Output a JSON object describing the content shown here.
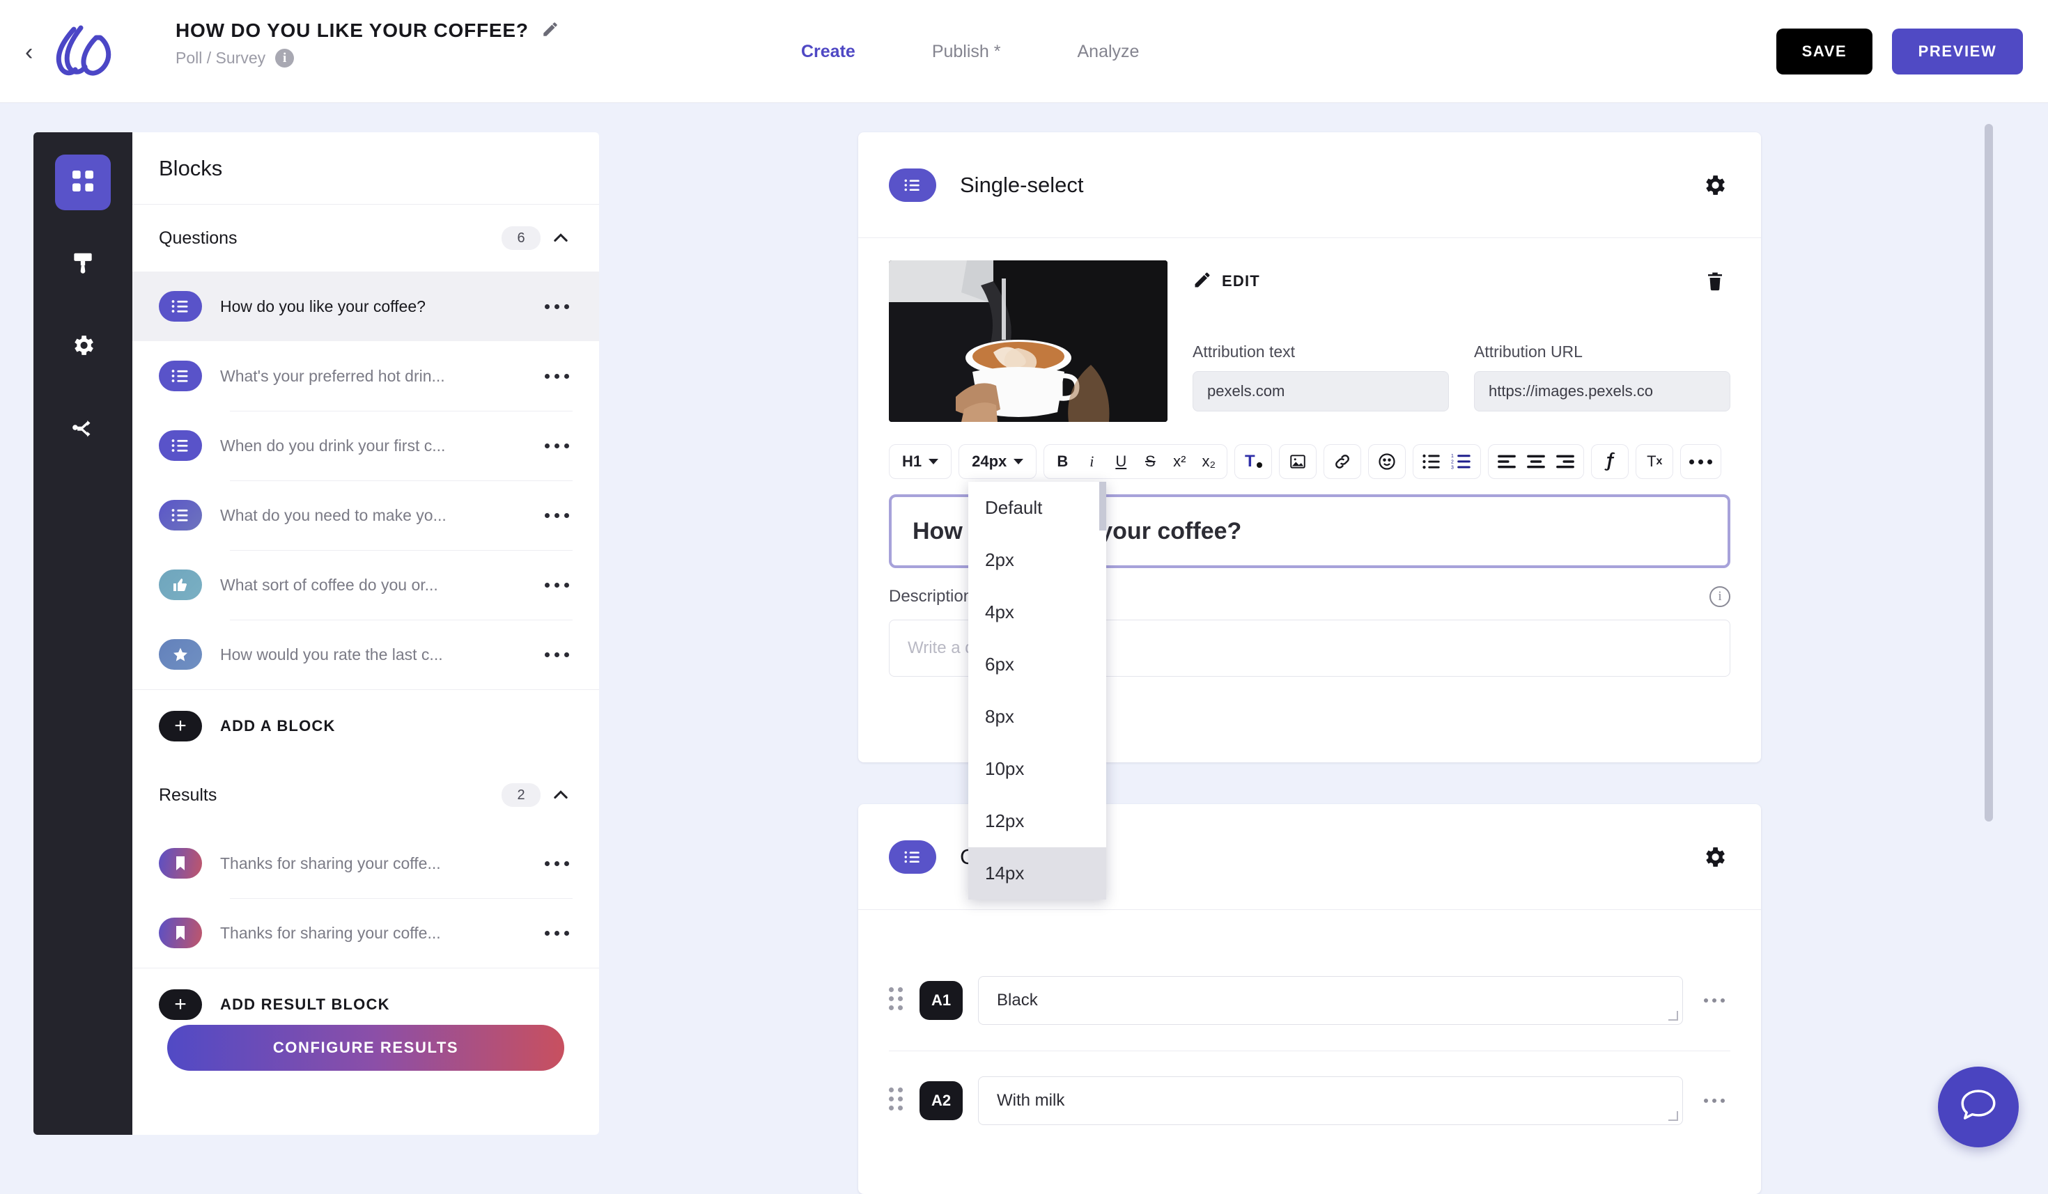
{
  "header": {
    "back_icon": "chevron-left-icon",
    "logo_icon": "brand-logo-icon",
    "doc_title": "HOW DO YOU LIKE YOUR COFFEE?",
    "edit_title_icon": "pencil-icon",
    "doc_subtitle": "Poll / Survey",
    "info_icon": "info-icon",
    "info_glyph": "i",
    "tabs": [
      {
        "label": "Create",
        "active": true
      },
      {
        "label": "Publish *",
        "active": false
      },
      {
        "label": "Analyze",
        "active": false
      }
    ],
    "save_label": "SAVE",
    "preview_label": "PREVIEW",
    "accent_color": "#504ac4",
    "save_color": "#000000"
  },
  "rail": {
    "items": [
      {
        "icon": "blocks-grid-icon",
        "active": true
      },
      {
        "icon": "paintbrush-icon",
        "active": false
      },
      {
        "icon": "gear-icon",
        "active": false
      },
      {
        "icon": "share-branch-icon",
        "active": false
      }
    ]
  },
  "blocks_panel": {
    "title": "Blocks",
    "questions_section": {
      "title": "Questions",
      "count": "6",
      "collapse_icon": "chevron-up-icon",
      "items": [
        {
          "label": "How do you like your coffee?",
          "icon": "single-select-icon",
          "badge_color": "#5953c9",
          "selected": true
        },
        {
          "label": "What's your preferred hot drin...",
          "icon": "single-select-icon",
          "badge_color": "#5953c9",
          "selected": false
        },
        {
          "label": "When do you drink your first c...",
          "icon": "single-select-icon",
          "badge_color": "#5953c9",
          "selected": false
        },
        {
          "label": "What do you need to make yo...",
          "icon": "multi-select-icon",
          "badge_color": "#5a62bf",
          "selected": false
        },
        {
          "label": "What sort of coffee do you or...",
          "icon": "thumbs-up-icon",
          "badge_color": "#6aa3bb",
          "selected": false
        },
        {
          "label": "How would you rate the last c...",
          "icon": "star-icon",
          "badge_color": "#6483b9",
          "selected": false
        }
      ],
      "add_label": "ADD A BLOCK",
      "add_icon": "plus-icon"
    },
    "results_section": {
      "title": "Results",
      "count": "2",
      "collapse_icon": "chevron-up-icon",
      "items": [
        {
          "label": "Thanks for sharing your coffe...",
          "icon": "bookmark-icon"
        },
        {
          "label": "Thanks for sharing your coffe...",
          "icon": "bookmark-icon"
        }
      ],
      "add_label": "ADD RESULT BLOCK",
      "add_icon": "plus-icon"
    },
    "configure_label": "CONFIGURE RESULTS",
    "row_menu_icon": "more-horizontal-icon"
  },
  "question_card": {
    "badge_icon": "single-select-icon",
    "title": "Single-select",
    "settings_icon": "gear-icon",
    "image_alt": "barista pouring latte art",
    "edit_label": "EDIT",
    "edit_icon": "pencil-icon",
    "delete_icon": "trash-icon",
    "attribution_text_label": "Attribution text",
    "attribution_text_value": "pexels.com",
    "attribution_url_label": "Attribution URL",
    "attribution_url_value": "https://images.pexels.co",
    "toolbar": {
      "heading_value": "H1",
      "font_size_value": "24px",
      "buttons": [
        {
          "icon": "bold-icon",
          "glyph": "B"
        },
        {
          "icon": "italic-icon",
          "glyph": "i"
        },
        {
          "icon": "underline-icon",
          "glyph": "U"
        },
        {
          "icon": "strikethrough-icon",
          "glyph": "S"
        },
        {
          "icon": "superscript-icon",
          "glyph": "x²"
        },
        {
          "icon": "subscript-icon",
          "glyph": "x₂"
        },
        {
          "icon": "text-color-icon",
          "glyph": "T"
        },
        {
          "icon": "image-icon",
          "glyph": ""
        },
        {
          "icon": "link-icon",
          "glyph": ""
        },
        {
          "icon": "emoji-icon",
          "glyph": ""
        },
        {
          "icon": "bullet-list-icon",
          "glyph": ""
        },
        {
          "icon": "numbered-list-icon",
          "glyph": ""
        },
        {
          "icon": "align-left-icon",
          "glyph": ""
        },
        {
          "icon": "align-center-icon",
          "glyph": ""
        },
        {
          "icon": "align-right-icon",
          "glyph": ""
        },
        {
          "icon": "formula-icon",
          "glyph": ""
        },
        {
          "icon": "clear-formatting-icon",
          "glyph": "Tx"
        },
        {
          "icon": "more-horizontal-icon",
          "glyph": ""
        }
      ]
    },
    "question_value": "How do you like your coffee?",
    "description_label": "Description",
    "description_info_icon": "info-icon",
    "description_placeholder": "Write a description.",
    "focus_ring_color": "#a7a2da"
  },
  "font_size_menu": {
    "options": [
      "Default",
      "2px",
      "4px",
      "6px",
      "8px",
      "10px",
      "12px",
      "14px"
    ],
    "highlighted": "14px"
  },
  "content_card": {
    "badge_icon": "single-select-icon",
    "title": "Content",
    "settings_icon": "gear-icon",
    "answers": [
      {
        "key": "A1",
        "value": "Black",
        "drag_icon": "drag-handle-icon",
        "menu_icon": "more-horizontal-icon"
      },
      {
        "key": "A2",
        "value": "With milk",
        "drag_icon": "drag-handle-icon",
        "menu_icon": "more-horizontal-icon"
      }
    ]
  },
  "chat_fab": {
    "icon": "chat-bubble-icon",
    "color": "#4a44c0"
  },
  "scrollbar": {
    "icon": "vertical-scrollbar-thumb"
  }
}
